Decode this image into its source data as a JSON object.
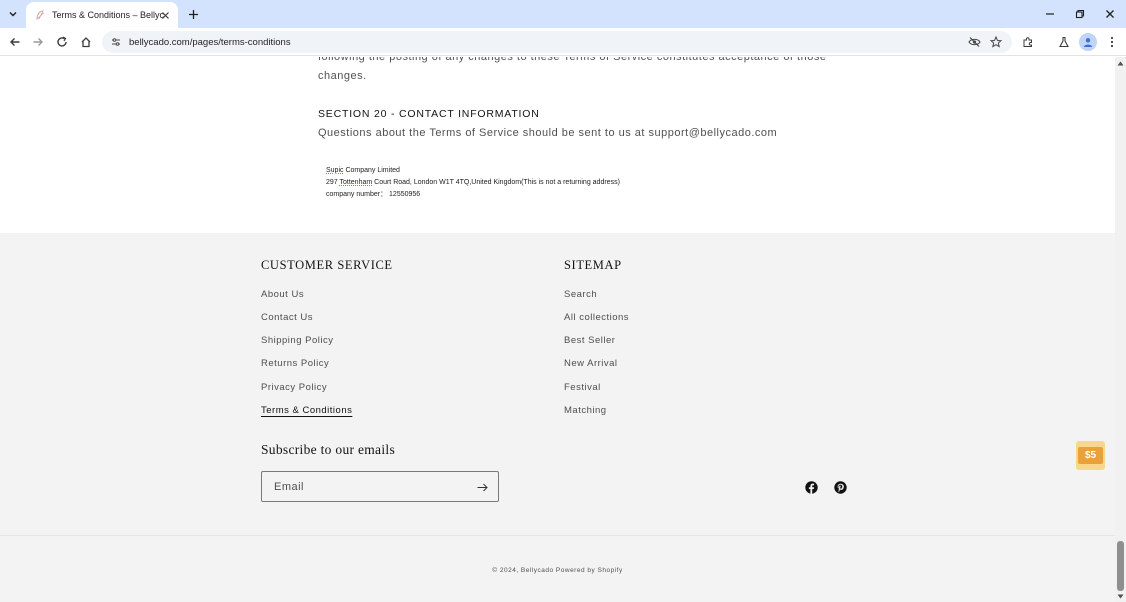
{
  "browser": {
    "tab_title": "Terms & Conditions – Bellycado",
    "url": "bellycado.com/pages/terms-conditions",
    "icons": {
      "tab_search": "chevron-down-icon",
      "favicon": "bellycado-favicon",
      "tab_close": "close-icon",
      "new_tab": "plus-icon",
      "minimize": "minimize-icon",
      "restore": "restore-icon",
      "close_window": "close-icon",
      "back": "arrow-left-icon",
      "forward": "arrow-right-icon",
      "reload": "reload-icon",
      "home": "home-icon",
      "site_info": "tune-icon",
      "eye_off": "eye-off-icon",
      "bookmark": "star-icon",
      "extensions": "puzzle-icon",
      "labs": "flask-icon",
      "profile": "person-icon",
      "menu": "kebab-menu-icon"
    }
  },
  "article": {
    "partial_line_1": "following the posting of any changes to these Terms of Service constitutes acceptance of those",
    "partial_line_2": "changes.",
    "section_heading": "SECTION 20 - CONTACT INFORMATION",
    "contact_text": "Questions about the Terms of Service should be sent to us at support@bellycado.com",
    "company": {
      "name_word": "Supic",
      "name_rest": " Company Limited",
      "addr_prefix": "297 ",
      "addr_word": "Tottenham",
      "addr_rest": " Court Road, London W1T 4TQ,United Kingdom(This is not a returning address)",
      "company_number": "company number： 12550956"
    }
  },
  "footer": {
    "customer_service": {
      "heading": "CUSTOMER SERVICE",
      "links": [
        "About Us",
        "Contact Us",
        "Shipping Policy",
        "Returns Policy",
        "Privacy Policy",
        "Terms & Conditions"
      ]
    },
    "sitemap": {
      "heading": "SITEMAP",
      "links": [
        "Search",
        "All collections",
        "Best Seller",
        "New Arrival",
        "Festival",
        "Matching"
      ]
    },
    "subscribe": {
      "heading": "Subscribe to our emails",
      "placeholder": "Email",
      "submit_icon": "arrow-right-icon"
    },
    "social": {
      "facebook_icon": "facebook-icon",
      "pinterest_icon": "pinterest-icon"
    },
    "copyright": "© 2024, Bellycado Powered by Shopify"
  },
  "promo": {
    "label": "$5",
    "icon": "coupon-icon"
  },
  "colors": {
    "tabstrip_bg": "#d3e3fd",
    "footer_bg": "#f3f3f3",
    "promo_outer": "#f6d88a",
    "promo_inner": "#e9a23b"
  }
}
